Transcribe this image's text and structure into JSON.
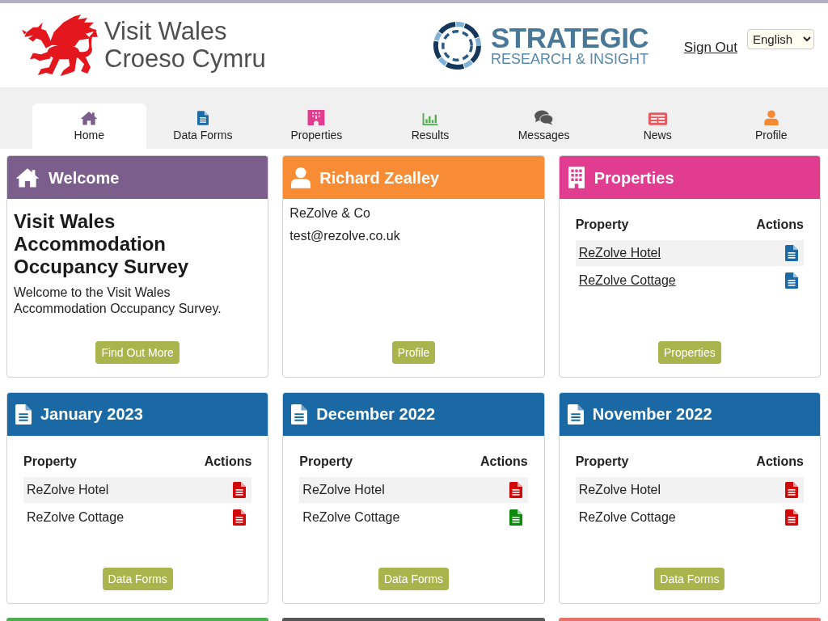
{
  "header": {
    "brand_lines": [
      "Visit Wales",
      "Croeso Cymru"
    ],
    "partner_lines": [
      "STRATEGIC",
      "RESEARCH & INSIGHT"
    ],
    "sign_out": "Sign Out",
    "language": "English"
  },
  "nav_tabs": [
    {
      "label": "Home",
      "color": "#7b5e8c",
      "selected": true
    },
    {
      "label": "Data Forms",
      "color": "#1b6aa5",
      "selected": false
    },
    {
      "label": "Properties",
      "color": "#e23c90",
      "selected": false
    },
    {
      "label": "Results",
      "color": "#4cae4c",
      "selected": false
    },
    {
      "label": "Messages",
      "color": "#555555",
      "selected": false
    },
    {
      "label": "News",
      "color": "#e8585e",
      "selected": false
    },
    {
      "label": "Profile",
      "color": "#f58a34",
      "selected": false
    }
  ],
  "cards": [
    {
      "kind": "welcome",
      "color": "#7b5e8c",
      "title": "Welcome",
      "heading": "Visit Wales Accommodation Occupancy Survey",
      "text": "Welcome to the Visit Wales Accommodation Occupancy Survey.",
      "button": "Find Out More"
    },
    {
      "kind": "contact",
      "color": "#f78c35",
      "title": "Richard Zealley",
      "lines": [
        "ReZolve & Co",
        "test@rezolve.co.uk"
      ],
      "button": "Profile"
    },
    {
      "kind": "property_list",
      "color": "#e23c90",
      "title": "Properties",
      "columns": [
        "Property",
        "Actions"
      ],
      "rows": [
        {
          "property": "ReZolve Hotel",
          "color": "#1b6aa5"
        },
        {
          "property": "ReZolve Cottage",
          "color": "#1b6aa5"
        }
      ],
      "button": "Properties"
    },
    {
      "kind": "month",
      "color": "#1a69a5",
      "title": "January 2023",
      "columns": [
        "Property",
        "Actions"
      ],
      "rows": [
        {
          "property": "ReZolve Hotel",
          "color": "#d00a0a"
        },
        {
          "property": "ReZolve Cottage",
          "color": "#d00a0a"
        }
      ],
      "button": "Data Forms"
    },
    {
      "kind": "month",
      "color": "#1a69a5",
      "title": "December 2022",
      "columns": [
        "Property",
        "Actions"
      ],
      "rows": [
        {
          "property": "ReZolve Hotel",
          "color": "#d00a0a"
        },
        {
          "property": "ReZolve Cottage",
          "color": "#0b8a0b"
        }
      ],
      "button": "Data Forms"
    },
    {
      "kind": "month",
      "color": "#1a69a5",
      "title": "November 2022",
      "columns": [
        "Property",
        "Actions"
      ],
      "rows": [
        {
          "property": "ReZolve Hotel",
          "color": "#d00a0a"
        },
        {
          "property": "ReZolve Cottage",
          "color": "#d00a0a"
        }
      ],
      "button": "Data Forms"
    },
    {
      "kind": "cut_off",
      "color": "#4cae50"
    },
    {
      "kind": "cut_off",
      "color": "#555555"
    },
    {
      "kind": "cut_off",
      "color": "#e8716c"
    }
  ]
}
